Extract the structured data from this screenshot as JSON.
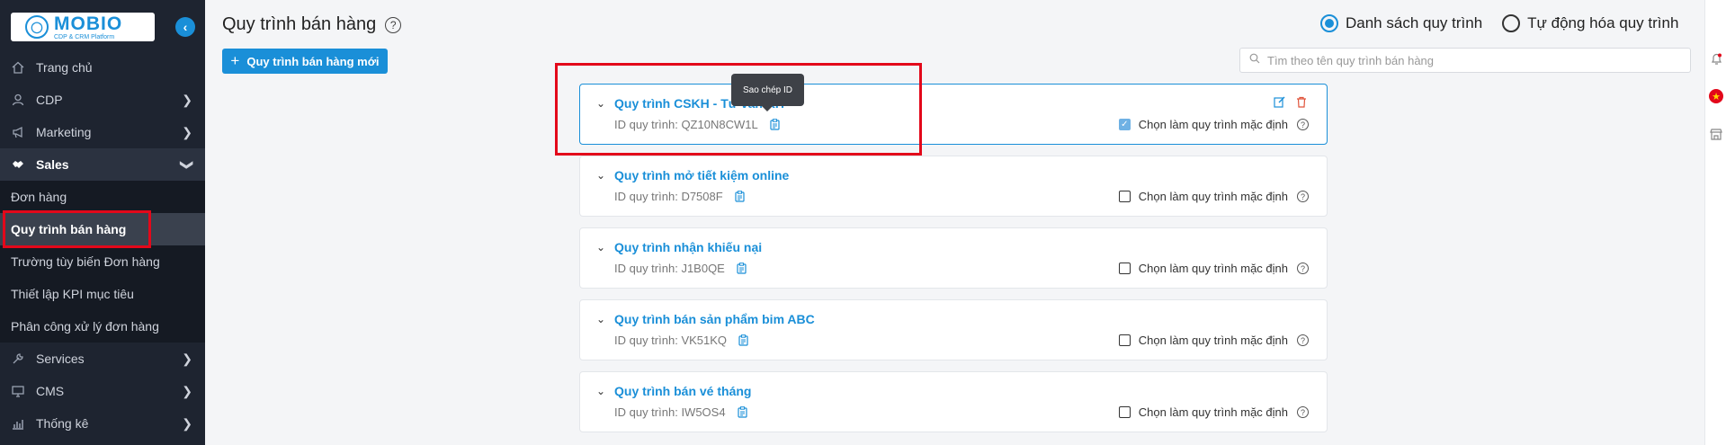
{
  "brand": {
    "name": "MOBIO",
    "tagline": "CDP & CRM Platform"
  },
  "sidebar": {
    "items": [
      {
        "label": "Trang chủ",
        "icon": "home-icon"
      },
      {
        "label": "CDP",
        "icon": "user-icon"
      },
      {
        "label": "Marketing",
        "icon": "megaphone-icon"
      },
      {
        "label": "Sales",
        "icon": "handshake-icon"
      },
      {
        "label": "Services",
        "icon": "tools-icon"
      },
      {
        "label": "CMS",
        "icon": "monitor-icon"
      },
      {
        "label": "Thống kê",
        "icon": "bar-chart-icon"
      }
    ],
    "sales_sub": [
      "Đơn hàng",
      "Quy trình bán hàng",
      "Trường tùy biến Đơn hàng",
      "Thiết lập KPI mục tiêu",
      "Phân công xử lý đơn hàng"
    ]
  },
  "header": {
    "title": "Quy trình bán hàng",
    "view_options": [
      "Danh sách quy trình",
      "Tự động hóa quy trình"
    ],
    "selected_view": "Danh sách quy trình"
  },
  "toolbar": {
    "new_button": "Quy trình bán hàng mới",
    "search_placeholder": "Tìm theo tên quy trình bán hàng"
  },
  "tooltip": "Sao chép ID",
  "processes": [
    {
      "name": "Quy trình CSKH - Tư vấn KH",
      "id_label": "ID quy trình:",
      "id": "QZ10N8CW1L",
      "is_default": true
    },
    {
      "name": "Quy trình mở tiết kiệm online",
      "id_label": "ID quy trình:",
      "id": "D7508F",
      "is_default": false
    },
    {
      "name": "Quy trình nhận khiếu nại",
      "id_label": "ID quy trình:",
      "id": "J1B0QE",
      "is_default": false
    },
    {
      "name": "Quy trình bán sản phẩm bim ABC",
      "id_label": "ID quy trình:",
      "id": "VK51KQ",
      "is_default": false
    },
    {
      "name": "Quy trình bán vé tháng",
      "id_label": "ID quy trình:",
      "id": "IW5OS4",
      "is_default": false
    }
  ],
  "default_label": "Chọn làm quy trình mặc định",
  "colors": {
    "accent": "#1a8fd8",
    "sidebar_bg": "#1e2430",
    "highlight": "#e3081a"
  }
}
